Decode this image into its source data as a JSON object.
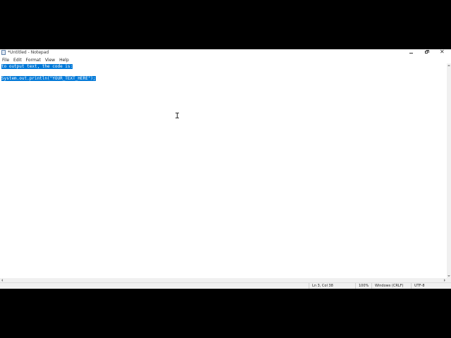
{
  "window": {
    "title": "*Untitled - Notepad",
    "app_icon": "notepad-icon"
  },
  "title_controls": {
    "minimize_icon": "minimize-icon",
    "maximize_icon": "restore-icon",
    "close_icon": "close-icon",
    "close_glyph": "✕"
  },
  "menu": {
    "items": [
      "File",
      "Edit",
      "Format",
      "View",
      "Help"
    ]
  },
  "editor": {
    "lines": [
      "to output text, the code is:",
      "",
      "System.out.println(\"YOUR_TEXT_HERE\");"
    ],
    "selected_lines": [
      0,
      2
    ],
    "selection_color": "#0078d7"
  },
  "status": {
    "position": "Ln 3, Col 38",
    "zoom": "100%",
    "line_ending": "Windows (CRLF)",
    "encoding": "UTF-8"
  },
  "colors": {
    "background": "#000000",
    "window": "#ffffff",
    "selection": "#0078d7",
    "statusbar": "#f0f0f0"
  }
}
